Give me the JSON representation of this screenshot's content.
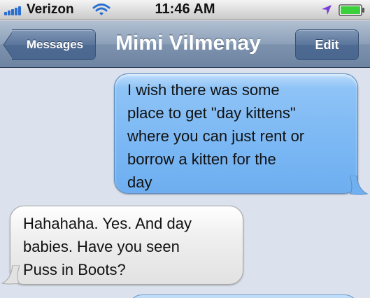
{
  "status_bar": {
    "carrier": "Verizon",
    "time": "11:46 AM",
    "icons": [
      "signal-icon",
      "wifi-icon",
      "location-arrow-icon",
      "battery-icon"
    ],
    "signal_color": "#2a6fd0",
    "battery_color": "#3cd13c",
    "location_color": "#7a3fd6"
  },
  "nav": {
    "back_label": "Messages",
    "title": "Mimi Vilmenay",
    "edit_label": "Edit"
  },
  "messages": [
    {
      "direction": "sent",
      "lines": [
        "I wish there was some",
        "place to get \"day kittens\"",
        "where you can just rent or",
        "borrow a kitten for the",
        "day"
      ]
    },
    {
      "direction": "received",
      "lines": [
        "Hahahaha. Yes. And day",
        "babies. Have you seen",
        "Puss in Boots?"
      ]
    }
  ],
  "colors": {
    "background": "#dbe2ed",
    "sent_bubble": "#7ab7f4",
    "received_bubble": "#e8e8e8",
    "nav_bar": "#8ca0b9"
  }
}
